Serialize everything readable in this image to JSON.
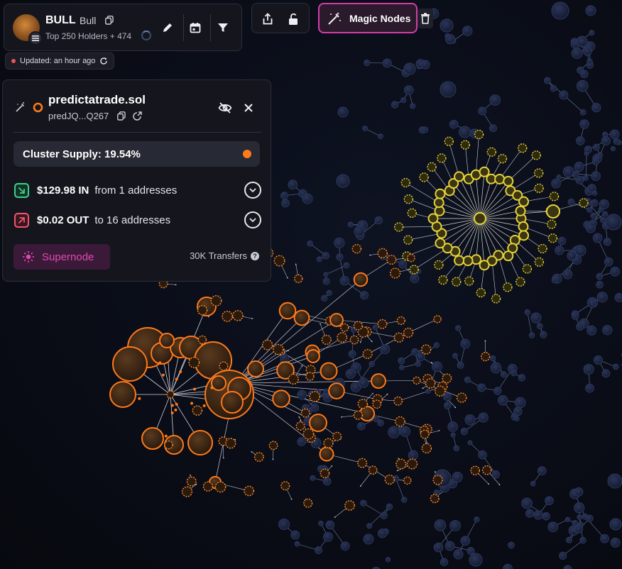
{
  "token": {
    "symbol": "BULL",
    "name": "Bull",
    "subtitle": "Top 250 Holders + 474",
    "updated": "Updated: an hour ago"
  },
  "toolbar": {
    "magic_nodes_label": "Magic Nodes"
  },
  "details": {
    "title": "predictatrade.sol",
    "address": "predJQ...Q267",
    "cluster_supply": "Cluster Supply: 19.54%",
    "inflow_amount": "$129.98 IN",
    "inflow_text": "from 1 addresses",
    "outflow_amount": "$0.02 OUT",
    "outflow_text": "to 16 addresses",
    "supernode_label": "Supernode",
    "transfers": "30K Transfers"
  },
  "colors": {
    "accent_magenta": "#d63ca7",
    "cluster_orange": "#ff7a1a",
    "cluster_yellow": "#e6d23a",
    "inflow_green": "#3fcf8e",
    "outflow_red": "#f0566a",
    "background_node": "#1b2440"
  },
  "icons": {
    "header": [
      "token-avatar",
      "solana-badge",
      "copy-icon",
      "pencil-icon",
      "calendar-icon",
      "filter-icon"
    ],
    "toolbar": [
      "share-icon",
      "unlock-icon",
      "magic-wand-icon",
      "trash-icon"
    ],
    "details": [
      "magic-wand-icon",
      "ring-icon",
      "copy-icon",
      "external-link-icon",
      "eye-off-icon",
      "close-icon",
      "arrow-in-icon",
      "arrow-out-icon",
      "chevron-down-icon",
      "sun-icon",
      "help-icon"
    ]
  }
}
